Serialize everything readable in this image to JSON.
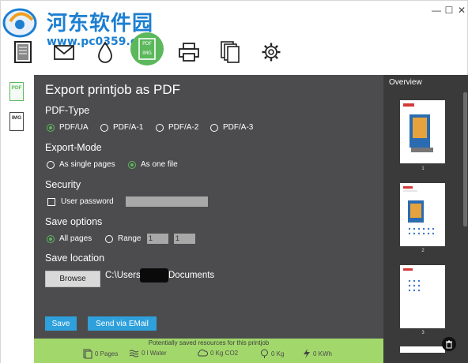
{
  "watermark": {
    "title": "河东软件园",
    "url": "www.pc0359.cn"
  },
  "window_controls": {
    "minimize": "—",
    "maximize": "☐",
    "close": "✕"
  },
  "toolbar": {
    "items": [
      "document-icon",
      "mail-icon",
      "drop-icon",
      "pdf-img-icon",
      "printer-icon",
      "copies-icon",
      "gear-icon"
    ],
    "active_badge_top": "PDF",
    "active_badge_bottom": "IMG"
  },
  "sidebar": {
    "pdf_label": "PDF",
    "img_label": "IMG"
  },
  "main": {
    "title": "Export printjob as PDF",
    "pdf_type": {
      "label": "PDF-Type",
      "options": [
        "PDF/UA",
        "PDF/A-1",
        "PDF/A-2",
        "PDF/A-3"
      ],
      "selected": "PDF/UA"
    },
    "export_mode": {
      "label": "Export-Mode",
      "options": [
        "As single pages",
        "As one file"
      ],
      "selected": "As one file"
    },
    "security": {
      "label": "Security",
      "user_password_label": "User password",
      "checked": false
    },
    "save_options": {
      "label": "Save options",
      "all_pages": "All pages",
      "range": "Range",
      "range_from": "1",
      "range_to": "1",
      "selected": "All pages"
    },
    "save_location": {
      "label": "Save location",
      "browse_label": "Browse",
      "path_prefix": "C:\\Users",
      "path_suffix": "Documents"
    },
    "save_button": "Save",
    "email_button": "Send via EMail"
  },
  "footer": {
    "title": "Potentially saved resources for this printjob",
    "stats": [
      {
        "icon": "pages-icon",
        "value": "0 Pages"
      },
      {
        "icon": "water-icon",
        "value": "0 l Water"
      },
      {
        "icon": "cloud-icon",
        "value": "0 Kg CO2"
      },
      {
        "icon": "tree-icon",
        "value": "0 Kg"
      },
      {
        "icon": "bolt-icon",
        "value": "0 KWh"
      }
    ]
  },
  "overview": {
    "title": "Overview",
    "page_numbers": [
      "1",
      "2",
      "3"
    ]
  },
  "colors": {
    "accent_green": "#5cb85c",
    "panel_dark": "#4c4c4e",
    "button_blue": "#2ea0dc",
    "footer_green": "#a2d86b"
  }
}
